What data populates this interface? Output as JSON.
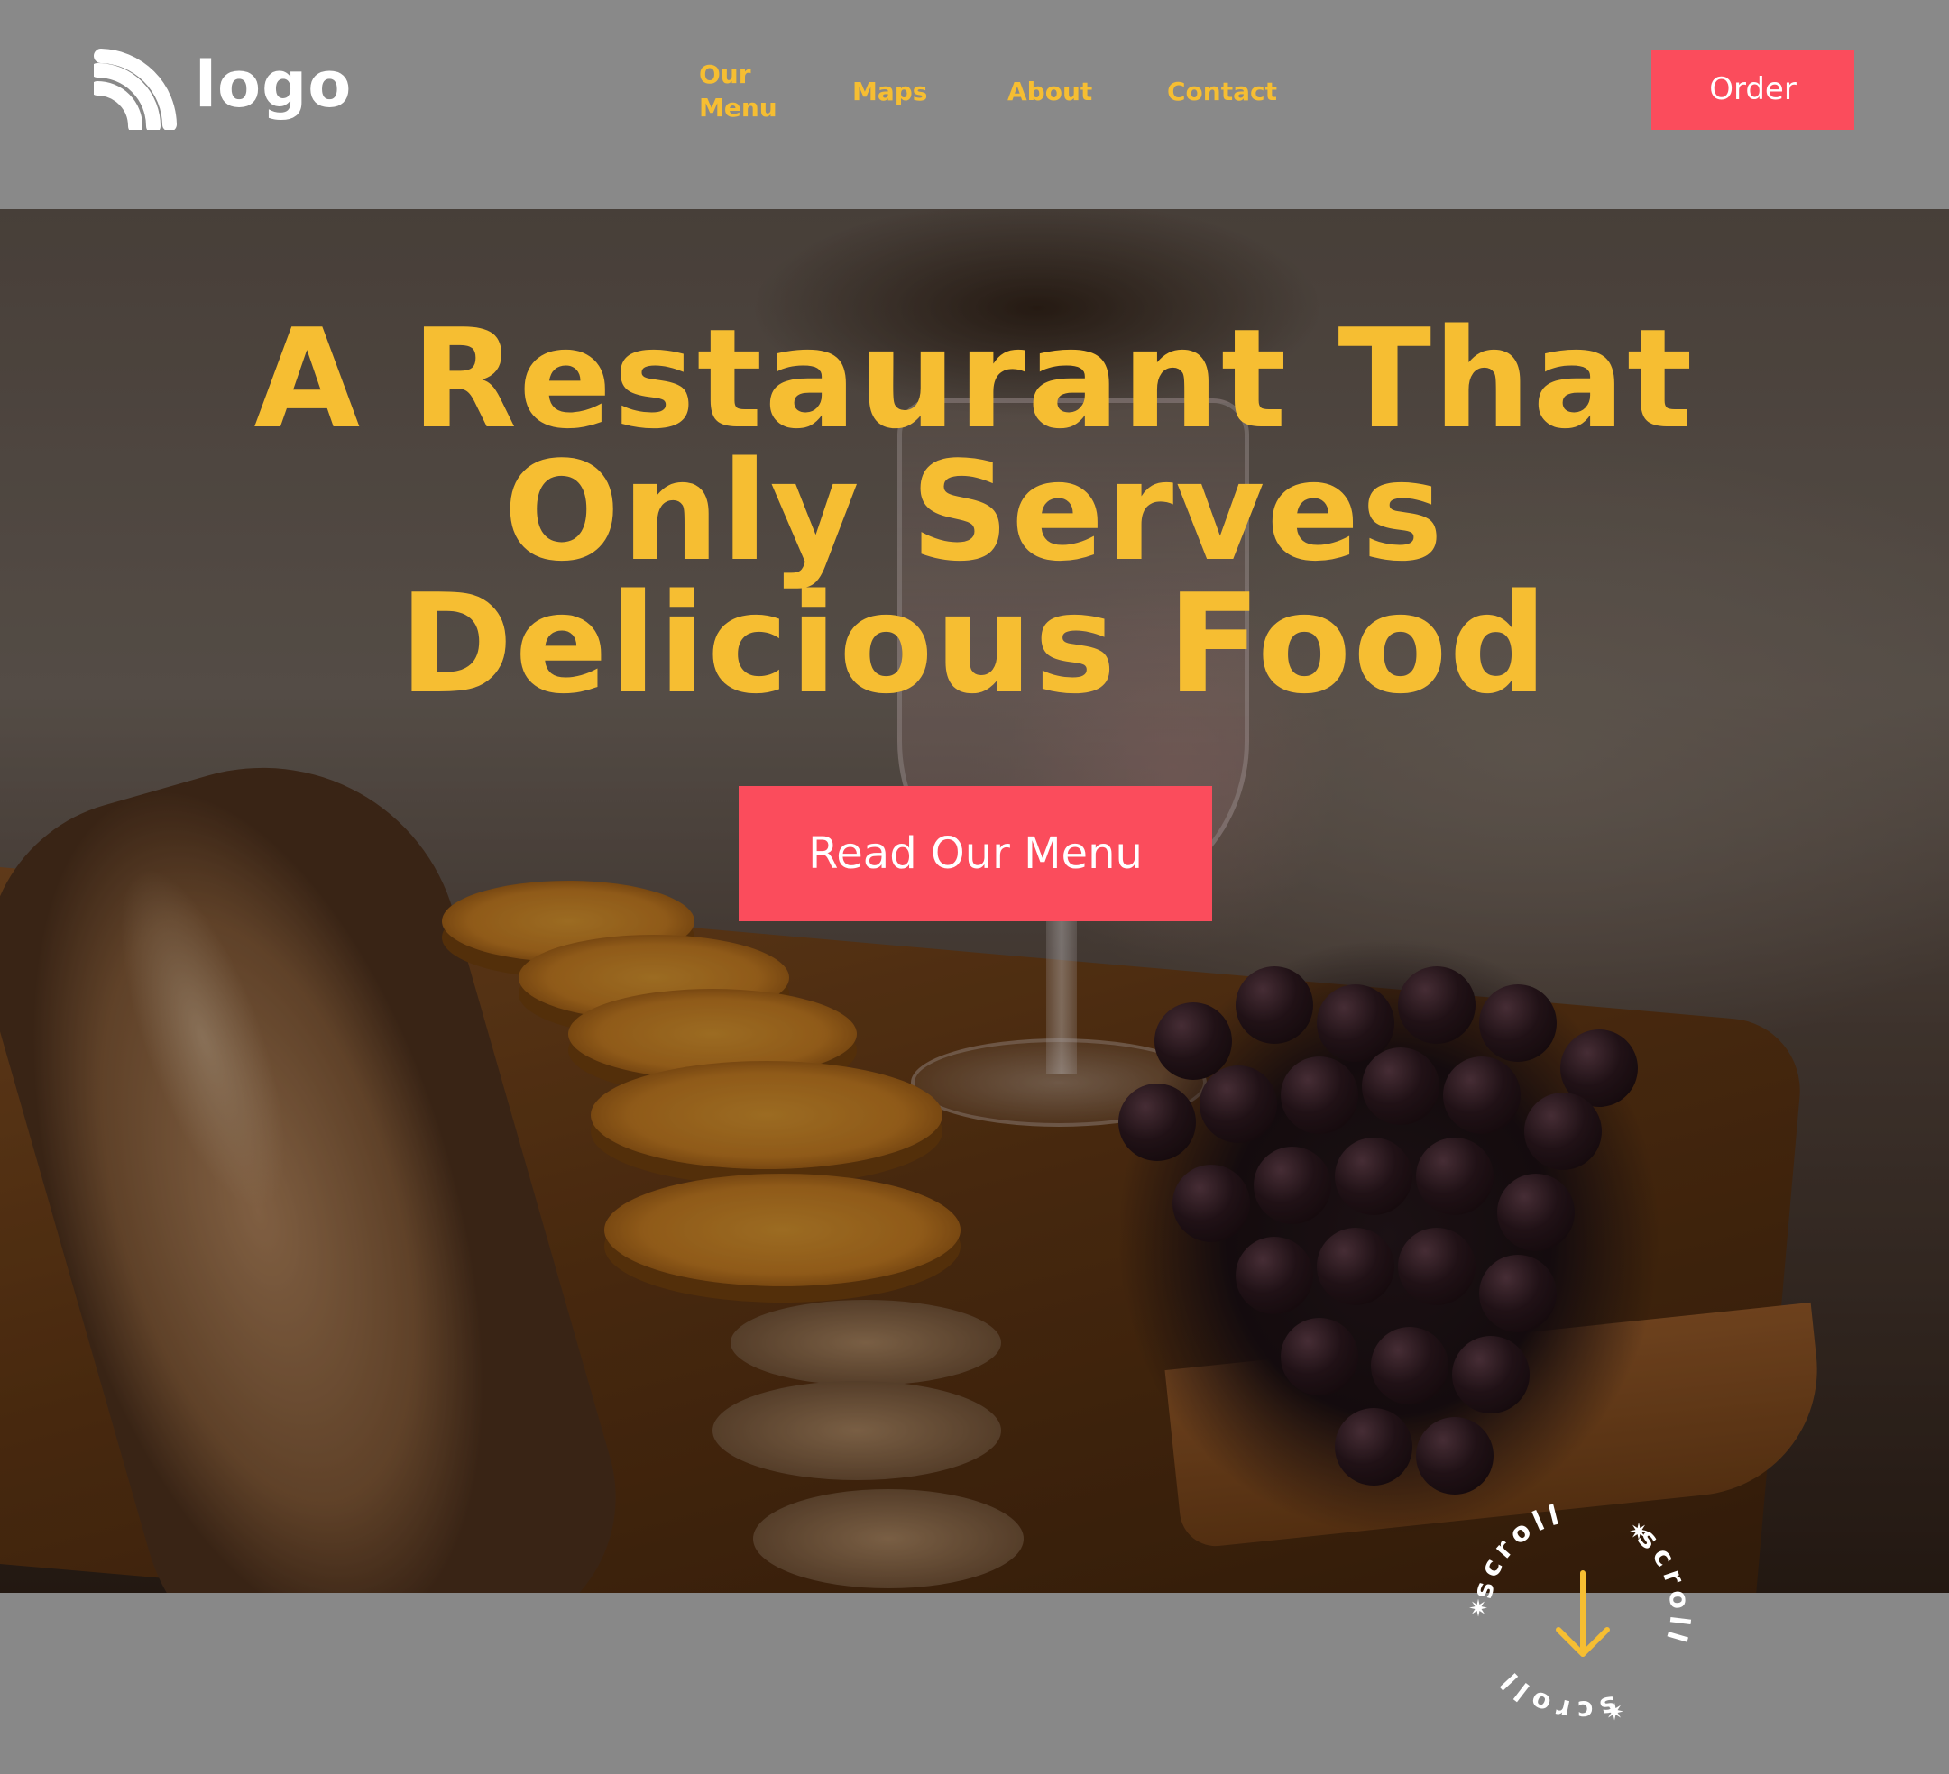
{
  "header": {
    "logo_text": "logo",
    "nav": [
      {
        "label": "Our\nMenu"
      },
      {
        "label": "Maps"
      },
      {
        "label": "About"
      },
      {
        "label": "Contact"
      }
    ],
    "order_label": "Order"
  },
  "hero": {
    "headline": "A Restaurant That Only Serves Delicious Food",
    "cta_label": "Read Our Menu"
  },
  "scroll": {
    "label": "scroll",
    "icon": "arrow-down-icon"
  },
  "colors": {
    "accent_yellow": "#f6be32",
    "accent_red": "#fb4c5c",
    "header_bg": "#898989",
    "footer_bg": "#888888"
  }
}
